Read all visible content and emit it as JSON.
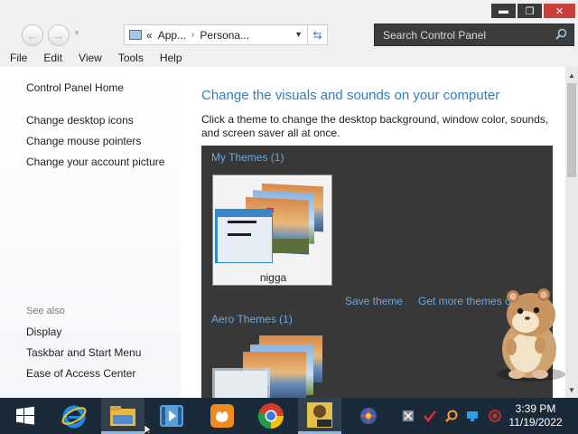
{
  "window": {
    "controls": {
      "minimize": "▬",
      "maximize": "❐",
      "close": "✕"
    }
  },
  "address": {
    "overflow": "«",
    "segments": [
      "App...",
      "Persona..."
    ],
    "separator": "›",
    "search_placeholder": "Search Control Panel"
  },
  "menu": [
    "File",
    "Edit",
    "View",
    "Tools",
    "Help"
  ],
  "left_nav": {
    "home": "Control Panel Home",
    "links": [
      "Change desktop icons",
      "Change mouse pointers",
      "Change your account picture"
    ],
    "see_also_title": "See also",
    "see_also_links": [
      "Display",
      "Taskbar and Start Menu",
      "Ease of Access Center"
    ]
  },
  "main": {
    "heading": "Change the visuals and sounds on your computer",
    "description": "Click a theme to change the desktop background, window color, sounds, and screen saver all at once.",
    "groups": [
      {
        "label": "My Themes (1)",
        "themes": [
          {
            "name": "nigga"
          }
        ]
      },
      {
        "label": "Aero Themes (1)"
      }
    ],
    "save_theme": "Save theme",
    "get_more_themes": "Get more themes o"
  },
  "taskbar": {
    "apps": [
      "start",
      "internet-explorer",
      "file-explorer",
      "media-player",
      "uc-browser",
      "chrome",
      "sandbox",
      "app-7"
    ],
    "tray_icons": [
      "tray-app-1",
      "tray-app-2",
      "tray-app-3",
      "tray-app-4",
      "tray-app-5"
    ],
    "clock_time": "3:39 PM",
    "clock_date": "11/19/2022"
  },
  "colors": {
    "accent": "#2f7fc1",
    "link": "#6aa8e0",
    "themes_bg": "#383838",
    "taskbar": "#1b2a39",
    "close_button": "#c7403a"
  }
}
